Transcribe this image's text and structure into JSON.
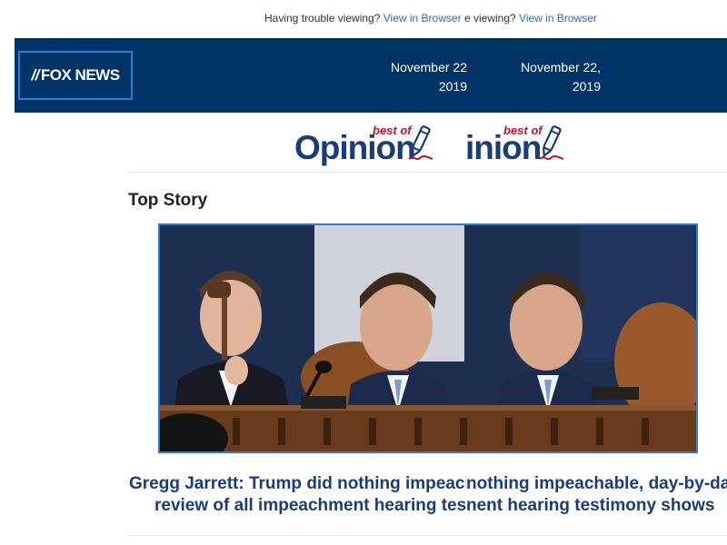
{
  "top_bar": {
    "trouble_text": "Having trouble viewing?",
    "view_link": "View in Browser",
    "trouble_text_clipped": "e viewing?",
    "view_link_2": "View in Browser"
  },
  "header": {
    "logo_text": "FOX NEWS",
    "date_line1": "November 22",
    "date_line2": "2019",
    "date2_line1": "November 22,",
    "date2_line2": "2019"
  },
  "opinion_banner": {
    "word": "Opinion",
    "word_clipped": "inion",
    "tag": "best of"
  },
  "section": {
    "title": "Top Story"
  },
  "story": {
    "headline_left_1": "Gregg Jarrett: Trump did nothing impeach",
    "headline_left_2": "review of all impeachment hearing tes",
    "headline_right_1": "nothing impeachable, day-by-day",
    "headline_right_2": "nent hearing testimony shows"
  },
  "colors": {
    "header_bg": "#003366",
    "link": "#2a6ebb",
    "headline": "#1a3d78",
    "opinion_word": "#1a3d78",
    "best_of": "#c8102e",
    "frame_border": "#2c7bd6"
  }
}
